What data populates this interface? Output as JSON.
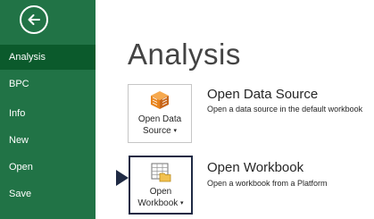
{
  "sidebar": {
    "items": [
      {
        "label": "Analysis",
        "active": true
      },
      {
        "label": "BPC",
        "active": false
      },
      {
        "label": "Info",
        "active": false
      },
      {
        "label": "New",
        "active": false
      },
      {
        "label": "Open",
        "active": false
      },
      {
        "label": "Save",
        "active": false
      }
    ]
  },
  "main": {
    "title": "Analysis",
    "entries": [
      {
        "button_line1": "Open Data",
        "button_line2": "Source",
        "title": "Open Data Source",
        "description": "Open a data source in the default workbook"
      },
      {
        "button_line1": "Open",
        "button_line2": "Workbook",
        "title": "Open Workbook",
        "description": "Open a workbook from a Platform"
      }
    ]
  },
  "colors": {
    "sidebar": "#217346",
    "active_item": "#0b5a2c",
    "selection": "#1f2a44",
    "cube_orange": "#e8841c"
  }
}
